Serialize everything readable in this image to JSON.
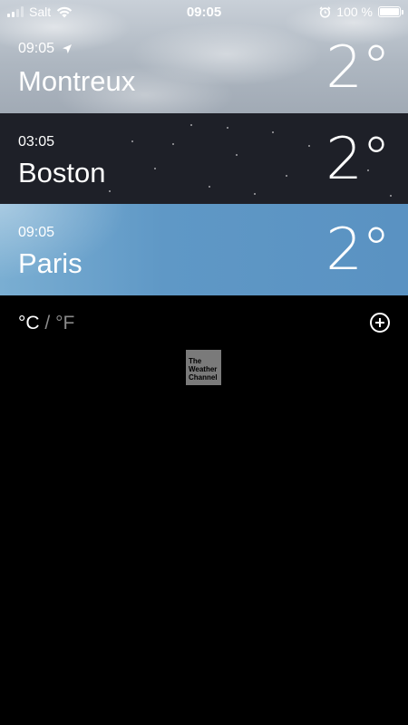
{
  "status_bar": {
    "carrier": "Salt",
    "time": "09:05",
    "battery_percent": "100 %"
  },
  "cities": [
    {
      "time": "09:05",
      "name": "Montreux",
      "temp": "2°",
      "current_location": true
    },
    {
      "time": "03:05",
      "name": "Boston",
      "temp": "2°",
      "current_location": false
    },
    {
      "time": "09:05",
      "name": "Paris",
      "temp": "2°",
      "current_location": false
    }
  ],
  "units": {
    "celsius": "°C",
    "separator": "/",
    "fahrenheit": "°F"
  },
  "footer": {
    "logo_lines": [
      "The",
      "Weather",
      "Channel"
    ]
  },
  "colors": {
    "boston_bg": "#1e2028",
    "paris_bg": "#5f98c6",
    "montreux_bg": "#aeb7c1",
    "inactive_unit": "#8a8a8a"
  },
  "icons": [
    "signal-icon",
    "wifi-icon",
    "alarm-icon",
    "battery-icon",
    "location-arrow-icon",
    "add-icon"
  ]
}
